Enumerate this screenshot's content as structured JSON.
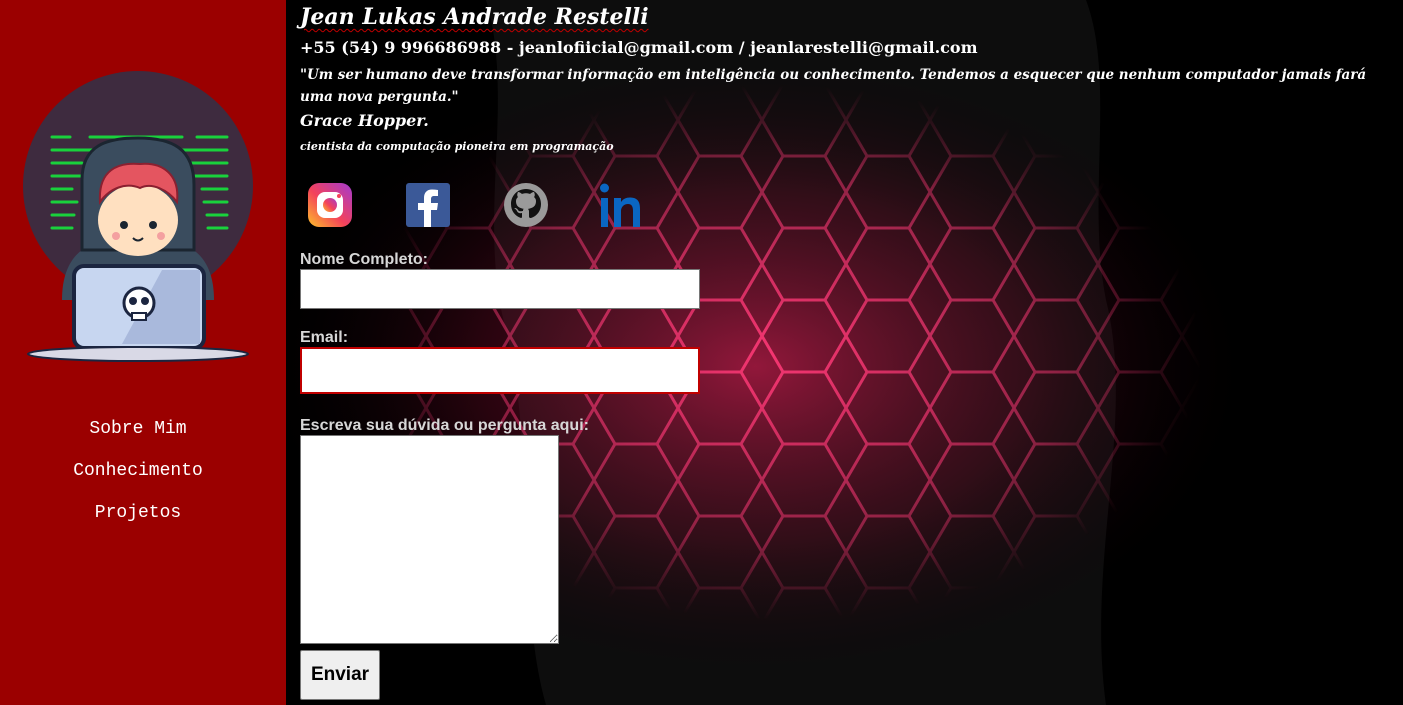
{
  "sidebar": {
    "nav": [
      {
        "label": "Sobre Mim"
      },
      {
        "label": "Conhecimento"
      },
      {
        "label": "Projetos"
      }
    ],
    "bg_color": "#9b0000"
  },
  "header": {
    "name": "Jean Lukas Andrade Restelli",
    "contact": "+55 (54) 9 996686988 - jeanlofiicial@gmail.com / jeanlarestelli@gmail.com",
    "quote": "\"Um ser humano deve transformar informação em inteligência ou conhecimento. Tendemos a esquecer que nenhum computador jamais fará uma nova pergunta.\"",
    "quote_author": "Grace Hopper.",
    "quote_author_role": "cientista da computação pioneira em programação"
  },
  "social": [
    {
      "icon": "instagram-icon"
    },
    {
      "icon": "facebook-icon"
    },
    {
      "icon": "github-icon"
    },
    {
      "icon": "linkedin-icon"
    }
  ],
  "form": {
    "name_label": "Nome Completo:",
    "name_value": "",
    "email_label": "Email:",
    "email_value": "",
    "question_label": "Escreva sua dúvida ou pergunta aqui:",
    "question_value": "",
    "submit_label": "Enviar"
  },
  "colors": {
    "accent": "#c00000",
    "hex_glow": "#ff2060"
  }
}
